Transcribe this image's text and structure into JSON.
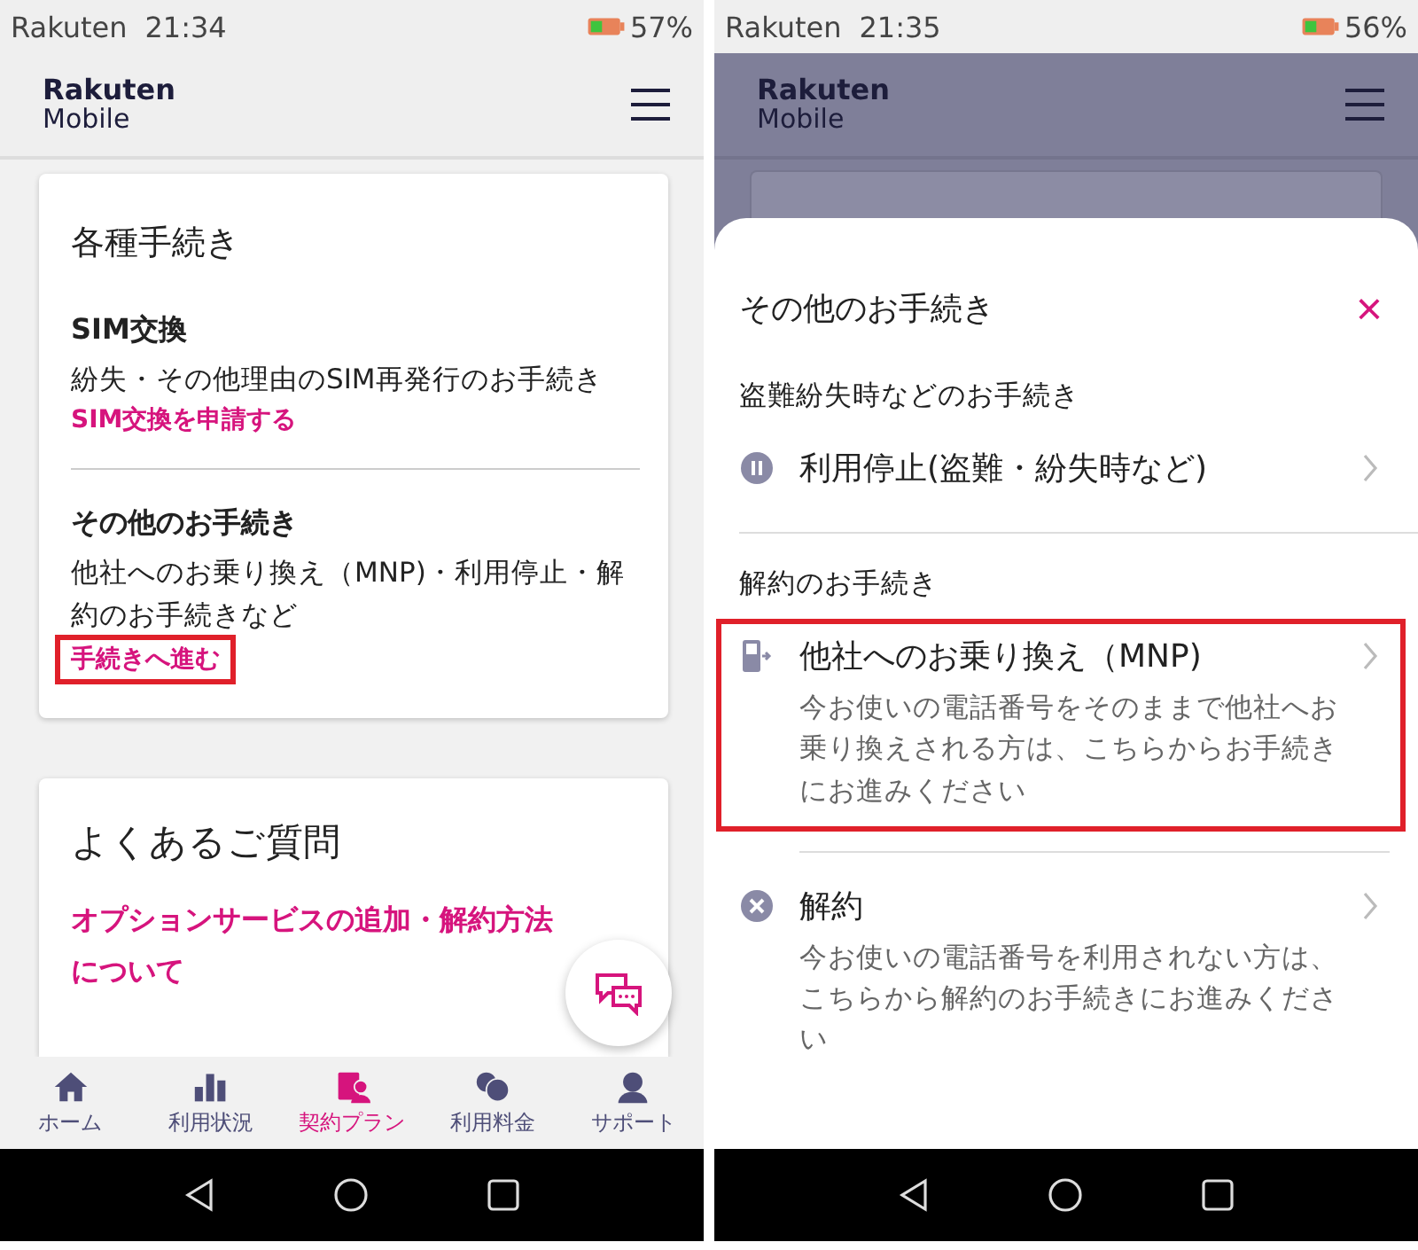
{
  "left_screen": {
    "status_bar": {
      "carrier": "Rakuten",
      "time": "21:34",
      "battery": "57%"
    },
    "header": {
      "logo_top": "Rakuten",
      "logo_bottom": "Mobile"
    },
    "procedures_card": {
      "title": "各種手続き",
      "sections": [
        {
          "heading": "SIM交換",
          "description": "紛失・その他理由のSIM再発行のお手続き",
          "link": "SIM交換を申請する",
          "highlighted": false
        },
        {
          "heading": "その他のお手続き",
          "description": "他社へのお乗り換え（MNP)・利用停止・解約のお手続きなど",
          "link": "手続きへ進む",
          "highlighted": true
        }
      ]
    },
    "faq_card": {
      "title": "よくあるご質問",
      "link": "オプションサービスの追加・解約方法について"
    },
    "bottom_nav": [
      {
        "label": "ホーム",
        "kind": "home",
        "selected": false
      },
      {
        "label": "利用状況",
        "kind": "chart",
        "selected": false
      },
      {
        "label": "契約プラン",
        "kind": "plan",
        "selected": true
      },
      {
        "label": "利用料金",
        "kind": "coins",
        "selected": false
      },
      {
        "label": "サポート",
        "kind": "support",
        "selected": false
      }
    ]
  },
  "right_screen": {
    "status_bar": {
      "carrier": "Rakuten",
      "time": "21:35",
      "battery": "56%"
    },
    "header": {
      "logo_top": "Rakuten",
      "logo_bottom": "Mobile"
    },
    "sheet": {
      "title": "その他のお手続き",
      "close": "×",
      "groups": [
        {
          "heading": "盗難紛失時などのお手続き",
          "items": [
            {
              "kind": "pause",
              "label": "利用停止(盗難・紛失時など)",
              "highlighted": false
            }
          ]
        },
        {
          "heading": "解約のお手続き",
          "items": [
            {
              "kind": "phone",
              "label": "他社へのお乗り換え（MNP)",
              "description": "今お使いの電話番号をそのままで他社へお乗り換えされる方は、こちらからお手続きにお進みください",
              "highlighted": true
            },
            {
              "kind": "cancel",
              "label": "解約",
              "description": "今お使いの電話番号を利用されない方は、こちらから解約のお手続きにお進みください",
              "highlighted": false
            }
          ]
        }
      ]
    }
  }
}
